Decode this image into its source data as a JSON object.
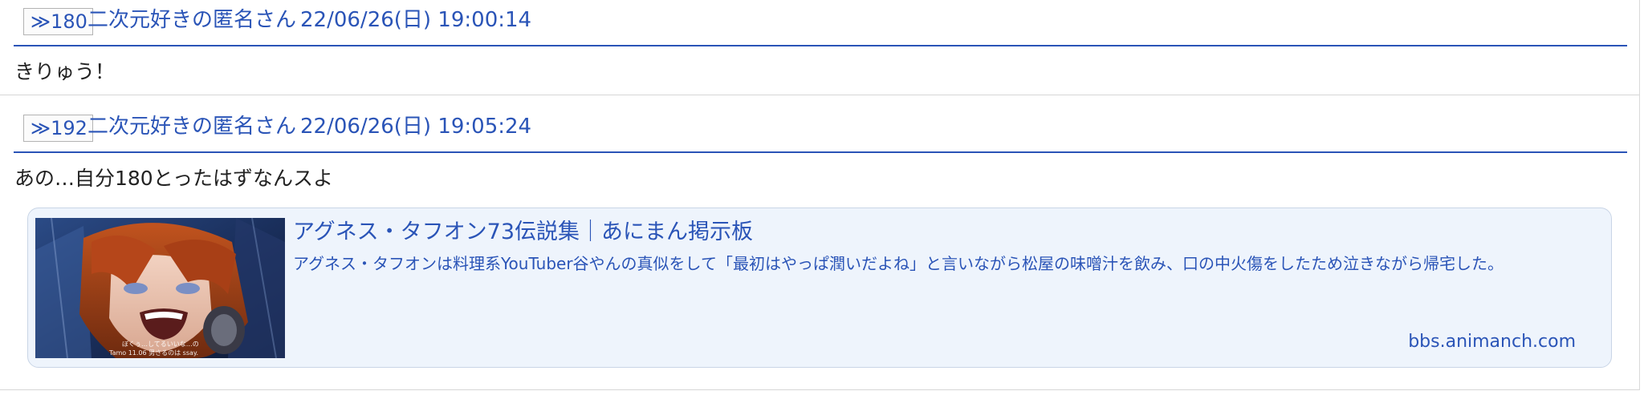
{
  "posts": [
    {
      "reply_label": "≫180",
      "poster_name": "二次元好きの匿名さん",
      "date": "22/06/26(日) 19:00:14",
      "body": "きりゅう！"
    },
    {
      "reply_label": "≫192",
      "poster_name": "二次元好きの匿名さん",
      "date": "22/06/26(日) 19:05:24",
      "body": "あの…自分180とったはずなんスよ",
      "link_card": {
        "title": "アグネス・タフオン73伝説集｜あにまん掲示板",
        "description": "アグネス・タフオンは料理系YouTuber谷やんの真似をして「最初はやっぱ潤いだよね」と言いながら松屋の味噌汁を飲み、口の中火傷をしたため泣きながら帰宅した。",
        "domain": "bbs.animanch.com",
        "thumbnail_caption": "ぼくぅ…してるいいな…の\nTamo 11.06 男さるのは ssay."
      }
    }
  ],
  "colors": {
    "link": "#2a54b7",
    "header_rule": "#2a54b7",
    "card_bg": "#eef4fc",
    "card_border": "#c9d5e6",
    "text": "#222222"
  }
}
